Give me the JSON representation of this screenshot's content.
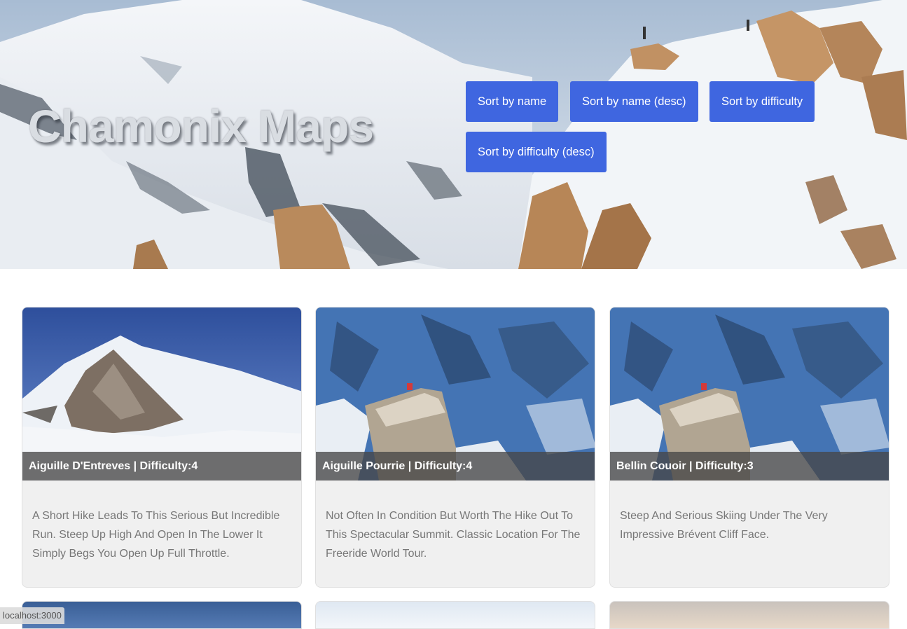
{
  "header": {
    "title": "Chamonix Maps",
    "sort_buttons": [
      {
        "label": "Sort by name"
      },
      {
        "label": "Sort by name (desc)"
      },
      {
        "label": "Sort by difficulty"
      },
      {
        "label": "Sort by difficulty (desc)"
      }
    ],
    "accent_color": "#3f66e0"
  },
  "cards": [
    {
      "caption": "Aiguille D'Entreves | Difficulty:4",
      "description": "A Short Hike Leads To This Serious But Incredible Run. Steep Up High And Open In The Lower It Simply Begs You Open Up Full Throttle."
    },
    {
      "caption": "Aiguille Pourrie | Difficulty:4",
      "description": "Not Often In Condition But Worth The Hike Out To This Spectacular Summit. Classic Location For The Freeride World Tour."
    },
    {
      "caption": "Bellin Couoir | Difficulty:3",
      "description": "Steep And Serious Skiing Under The Very Impressive Brévent Cliff Face."
    }
  ],
  "status_bar": {
    "url": "localhost:3000"
  }
}
